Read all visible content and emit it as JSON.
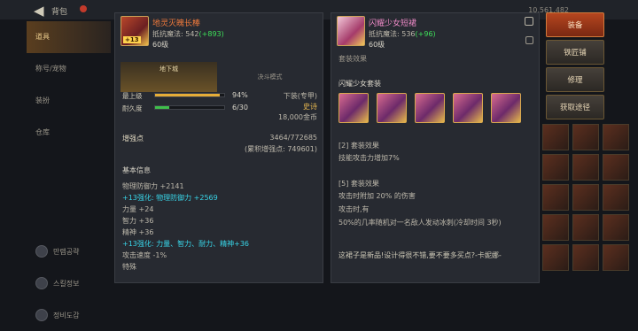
{
  "top": {
    "back_label": "背包",
    "currency": "10,561,482"
  },
  "nav": {
    "items": [
      {
        "label": "道具",
        "active": true
      },
      {
        "label": "称号/宠物"
      },
      {
        "label": "装扮"
      },
      {
        "label": "仓库"
      }
    ],
    "bottom_items": [
      "만렙공략",
      "스킬정보",
      "정비도감"
    ]
  },
  "left_item": {
    "name": "地灵灭魄长棒",
    "badge": "+13",
    "stat_label": "抵抗魔法:",
    "stat_value": "542",
    "stat_bonus": "(+893)",
    "level": "60级",
    "tab_active": "地下城",
    "tab_inactive": "决斗模式",
    "upgrade_label": "最上级",
    "upgrade_percent": 94,
    "upgrade_value": "94%",
    "durability_label": "耐久度",
    "durability_percent": 20,
    "durability_value": "6/30",
    "side_type": "下装(专甲)",
    "side_grade": "史诗",
    "side_price": "18,000金币",
    "growth_label": "增强点",
    "growth_value": "3464/772685",
    "growth_total": "(累积增强点: 749601)",
    "basic_info_title": "基本信息",
    "details": [
      {
        "text": "物理防御力 +2141",
        "color": "normal"
      },
      {
        "text": "+13强化: 物理防御力 +2569",
        "color": "cyan"
      },
      {
        "text": "力量 +24",
        "color": "normal"
      },
      {
        "text": "智力 +36",
        "color": "normal"
      },
      {
        "text": "精神 +36",
        "color": "normal"
      },
      {
        "text": "+13强化: 力量、智力、耐力、精神+36",
        "color": "cyan"
      },
      {
        "text": "攻击速度 -1%",
        "color": "normal"
      },
      {
        "text": "特殊",
        "color": "normal"
      }
    ]
  },
  "right_item": {
    "name": "闪耀少女短裙",
    "stat_label": "抵抗魔法:",
    "stat_value": "536",
    "stat_bonus": "(+96)",
    "level": "60级",
    "scroll_cut_title": "套装效果",
    "set_name": "闪耀少女套装",
    "set_icons": [
      "set-item-1",
      "set-item-2",
      "set-item-3",
      "set-item-4",
      "set-item-5"
    ],
    "set2_title": "[2] 套装效果",
    "set2_text": "技能攻击力增加7%",
    "set5_title": "[5] 套装效果",
    "set5_lines": [
      "攻击时附加 20% 的伤害",
      "攻击时,有",
      "50%的几率随机对一名敌人发动冰刺(冷却时间 3秒)"
    ],
    "flavor": "这裙子是新品!设计得很不错,要不要多买点?-卡妮娜-"
  },
  "actions": {
    "equip": "装备",
    "blacksmith": "铁匠铺",
    "repair": "修理",
    "get_path": "获取途径"
  },
  "colors": {
    "epic_orange": "#f07a3c",
    "pink_name": "#ef8bc8",
    "cyan_bonus": "#38d5e8",
    "green_bonus": "#3ee05a",
    "gold": "#e3b54f"
  }
}
